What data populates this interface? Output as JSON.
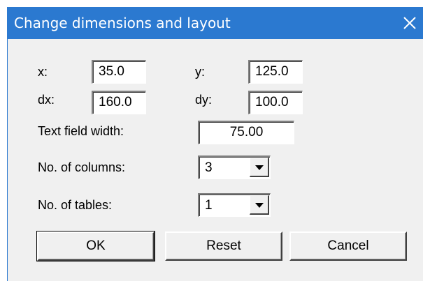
{
  "window": {
    "title": "Change dimensions and layout",
    "close_icon": "close-icon"
  },
  "fields": {
    "x_label": "x:",
    "x_value": "35.0",
    "y_label": "y:",
    "y_value": "125.0",
    "dx_label": "dx:",
    "dx_value": "160.0",
    "dy_label": "dy:",
    "dy_value": "100.0",
    "text_width_label": "Text field width:",
    "text_width_value": "75.00",
    "columns_label": "No. of columns:",
    "columns_value": "3",
    "tables_label": "No. of tables:",
    "tables_value": "1"
  },
  "buttons": {
    "ok": "OK",
    "reset": "Reset",
    "cancel": "Cancel"
  },
  "colors": {
    "titlebar": "#2b79d0",
    "dialog_bg": "#f0f0f0"
  }
}
